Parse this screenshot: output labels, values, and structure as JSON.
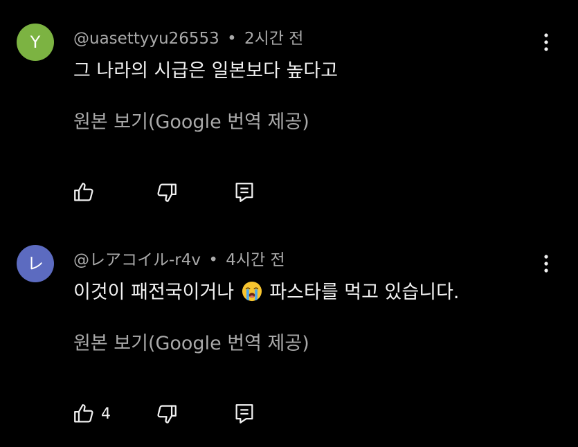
{
  "colors": {
    "background": "#000000",
    "text_primary": "#f1f1f1",
    "text_secondary": "#aaaaaa",
    "avatar_y": "#7cb342",
    "avatar_re": "#5c6bc0"
  },
  "comments": [
    {
      "avatar_letter": "Y",
      "author": "@uasettyyu26553",
      "separator": "•",
      "time": "2시간 전",
      "text": "그 나라의 시급은 일본보다 높다고",
      "translate_link": "원본 보기(Google 번역 제공)",
      "like_count": "",
      "icons": [
        "thumbs-up-icon",
        "thumbs-down-icon",
        "reply-icon",
        "more-vert-icon"
      ]
    },
    {
      "avatar_letter": "レ",
      "author": "@レアコイル-r4v",
      "separator": "•",
      "time": "4시간 전",
      "text_before_emoji": "이것이 패전국이거나",
      "emoji": "loudly-crying-face-icon",
      "text_after_emoji": "파스타를 먹고 있습니다.",
      "translate_link": "원본 보기(Google 번역 제공)",
      "like_count": "4",
      "icons": [
        "thumbs-up-icon",
        "thumbs-down-icon",
        "reply-icon",
        "more-vert-icon"
      ]
    }
  ]
}
